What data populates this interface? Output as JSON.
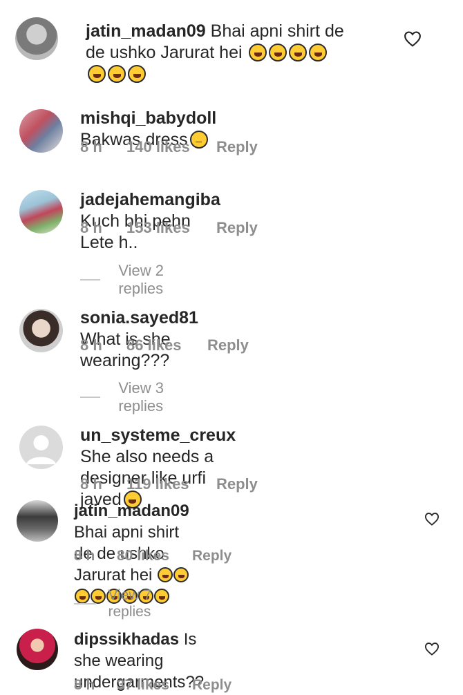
{
  "comments": [
    {
      "username": "jatin_madan09",
      "text1": "Bhai apni shirt de",
      "text2": "de ushko Jarurat hei"
    },
    {
      "username": "mishqi_babydoll",
      "text": "Bakwas dress",
      "time": "8 h",
      "likes": "140 likes",
      "reply": "Reply"
    },
    {
      "username": "jadejahemangiba",
      "text": "Kuch bhi pehn Lete h..",
      "time": "8 h",
      "likes": "153 likes",
      "reply": "Reply"
    },
    {
      "username": "sonia.sayed81",
      "text": "What is she wearing???",
      "time": "8 h",
      "likes": "86 likes",
      "reply": "Reply"
    },
    {
      "username": "un_systeme_creux",
      "text1": "She also needs a",
      "text2": "designer like urfi javed",
      "time": "8 h",
      "likes": "119 likes",
      "reply": "Reply"
    },
    {
      "username": "jatin_madan09",
      "text1": "Bhai apni shirt de de ushko",
      "text2": "Jarurat hei",
      "time": "8 h",
      "likes": "80 likes",
      "reply": "Reply"
    },
    {
      "username": "dipssikhadas",
      "text1": "Is she wearing",
      "text2": "undergarments??",
      "time": "8 h",
      "likes": "37 likes",
      "reply": "Reply"
    }
  ],
  "view_replies": [
    "View 2 replies",
    "View 3 replies",
    "View 7 replies"
  ],
  "icons": {
    "like": "heart-outline-icon",
    "emoji_laugh": "rofl-emoji",
    "emoji_roll": "eye-roll-emoji",
    "emoji_joy": "grinning-sweat-emoji"
  },
  "colors": {
    "text": "#262626",
    "meta": "#8e8e8e",
    "line": "#c7c7c7",
    "emoji": "#ffcc33"
  }
}
